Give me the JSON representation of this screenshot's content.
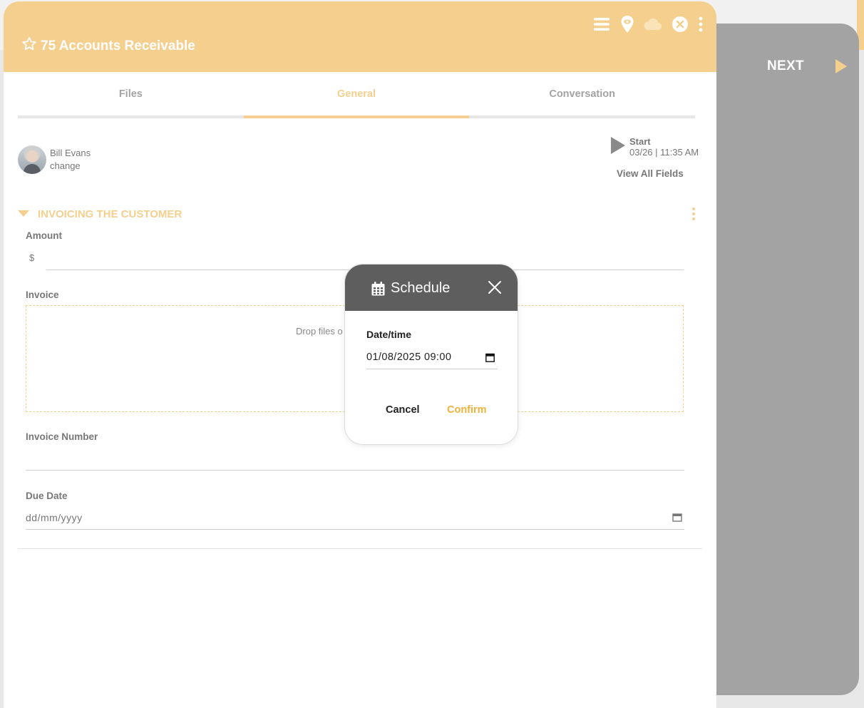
{
  "header": {
    "record_number": "75",
    "title": "75 Accounts Receivable",
    "icons": [
      "menu-icon",
      "location-eye-icon",
      "cloud-icon",
      "close-circle-icon",
      "more-vertical-icon"
    ]
  },
  "side_panel": {
    "next_label": "NEXT"
  },
  "tabs": [
    {
      "label": "Files",
      "active": false
    },
    {
      "label": "General",
      "active": true
    },
    {
      "label": "Conversation",
      "active": false
    }
  ],
  "user": {
    "name": "Bill Evans",
    "change_label": "change"
  },
  "start": {
    "label": "Start",
    "time": "03/26 | 11:35 AM",
    "view_all_label": "View All Fields"
  },
  "section": {
    "title": "INVOICING THE CUSTOMER",
    "fields": {
      "amount_label": "Amount",
      "currency_symbol": "$",
      "invoice_label": "Invoice",
      "dropzone_text": "Drop files o",
      "invoice_number_label": "Invoice Number",
      "due_date_label": "Due Date",
      "due_date_placeholder": "dd/mm/yyyy"
    }
  },
  "modal": {
    "title": "Schedule",
    "datetime_label": "Date/time",
    "datetime_value": "01/08/2025 09:00",
    "cancel_label": "Cancel",
    "confirm_label": "Confirm"
  },
  "colors": {
    "accent": "#f5cf8e",
    "confirm": "#f0b23a",
    "side_panel": "#a3a3a3",
    "modal_header": "#5e5e5e"
  }
}
